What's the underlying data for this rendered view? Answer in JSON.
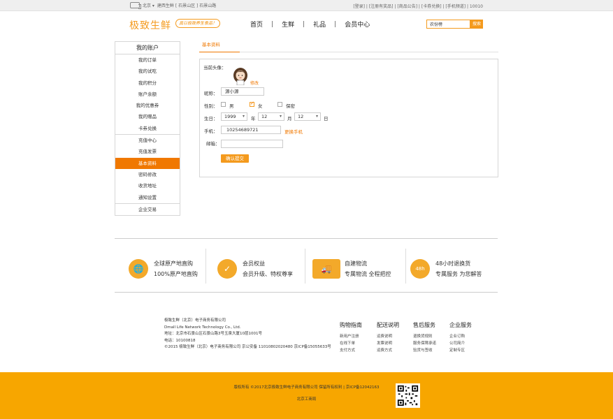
{
  "topbar": {
    "city": "北京 ▾",
    "addr": "建西生鲜 [ 石景山区 ] 石景山路",
    "right": "[登录]  |  [注册有奖品]  |  [商品公告]  |  [卡券兑换]  |  [手机频道]  |  10010"
  },
  "header": {
    "logo": "极致生鲜",
    "slogan": "真以极致养生食品！",
    "nav": [
      "首页",
      "生鲜",
      "礼品",
      "会员中心"
    ],
    "search_value": "农份榜",
    "search_btn": "搜索"
  },
  "sidebar": {
    "title": "我的账户",
    "groups": [
      [
        "我的订单",
        "我的试吃",
        "我的积分",
        "账户余额",
        "我的优惠券",
        "我的赠品",
        "卡券兑换"
      ],
      [
        "充值中心",
        "充值发票",
        "基本资料",
        "密码修改",
        "收货地址",
        "通知设置"
      ],
      [
        "企业交易"
      ]
    ]
  },
  "profile": {
    "tab": "基本资料",
    "avatar_label": "当前头像：",
    "edit": "修改",
    "nickname_label": "昵称：",
    "nickname": "源小源",
    "gender_label": "性别：",
    "male": "男",
    "female": "女",
    "secret": "保密",
    "birthday_label": "生日：",
    "year": "1999",
    "year_unit": "年",
    "month": "12",
    "month_unit": "月",
    "day": "12",
    "day_unit": "日",
    "phone_label": "手机：",
    "phone": "10254689721",
    "change_phone": "更换手机",
    "email_label": "邮箱：",
    "email": "",
    "submit": "确认提交"
  },
  "features": [
    {
      "t1": "全球原产地直购",
      "t2": "100%原产地直购"
    },
    {
      "t1": "会员权益",
      "t2": "会员升级、特权尊享"
    },
    {
      "t1": "自建物流",
      "t2": "专属物流 全程把控"
    },
    {
      "t1": "48小时退换货",
      "t2": "专属服务 为您解答"
    }
  ],
  "company": {
    "name": "极致生鲜（北京）电子商务有限公司",
    "name_en": "Dmall Life Network Technology Co., Ltd.",
    "address": "地址：北京市石景山区石景山路3号玉泉大厦10层1001号",
    "tel": "电话：10100818",
    "copyright": "©2015  极致生鲜（北京）电子商务有限公司  京公安备  11010802020480  京ICP备15055633号"
  },
  "footer_cols": [
    {
      "h": "购物指南",
      "l": [
        "新用户注册",
        "在线下单",
        "支付方式"
      ]
    },
    {
      "h": "配送说明",
      "l": [
        "运费说明",
        "发票说明",
        "运费方式"
      ]
    },
    {
      "h": "售后服务",
      "l": [
        "退换货规则",
        "服务保障承诺",
        "验货与签收"
      ]
    },
    {
      "h": "企业服务",
      "l": [
        "企业订购",
        "公司简介",
        "定制专区"
      ]
    }
  ],
  "band": {
    "line1": "版权所有 ©2017北京极致生鲜电子商务有限公司 保留所有权利 | 京ICP备12042163",
    "line2": "北京工商局"
  },
  "colors": {
    "accent": "#f07800",
    "band": "#f7a600"
  }
}
